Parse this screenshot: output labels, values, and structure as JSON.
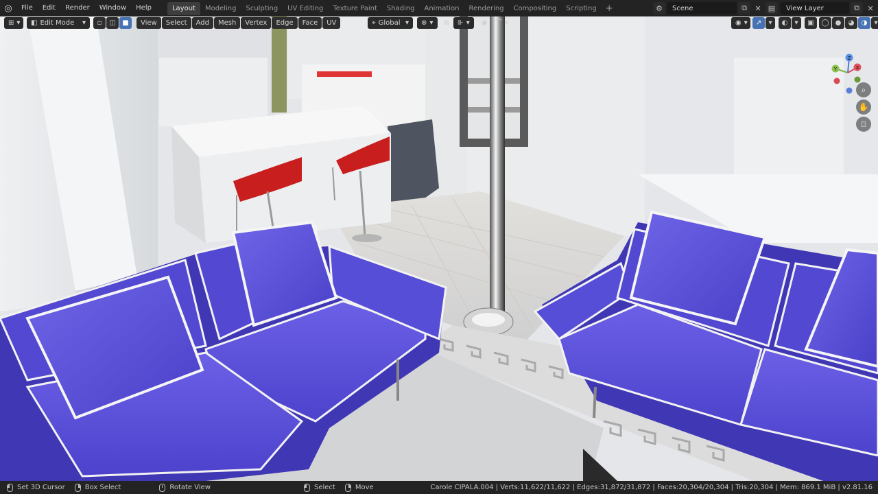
{
  "menu": [
    "File",
    "Edit",
    "Render",
    "Window",
    "Help"
  ],
  "workspaces": [
    "Layout",
    "Modeling",
    "Sculpting",
    "UV Editing",
    "Texture Paint",
    "Shading",
    "Animation",
    "Rendering",
    "Compositing",
    "Scripting"
  ],
  "active_workspace": "Layout",
  "add_workspace_label": "+",
  "scene_name": "Scene",
  "view_layer": "View Layer",
  "viewport_header": {
    "mode": "Edit Mode",
    "menus": [
      "View",
      "Select",
      "Add",
      "Mesh",
      "Vertex",
      "Edge",
      "Face",
      "UV"
    ],
    "orientation": "Global"
  },
  "gizmo": {
    "x": "X",
    "y": "Y",
    "z": "Z"
  },
  "status": {
    "left_click": "Set 3D Cursor",
    "right_click": "Box Select",
    "middle": "Rotate View",
    "select": "Select",
    "move": "Move",
    "stats": "Carole CIPALA.004 | Verts:11,622/11,622 | Edges:31,872/31,872 | Faces:20,304/20,304 | Tris:20,304 | Mem: 869.1 MiB | v2.81.16"
  },
  "colors": {
    "sofa": "#5a4fd6",
    "sofa_dark": "#3e34b0",
    "stool": "#c81e1e",
    "ui_dark": "#232323",
    "ui_active": "#4772b3"
  }
}
